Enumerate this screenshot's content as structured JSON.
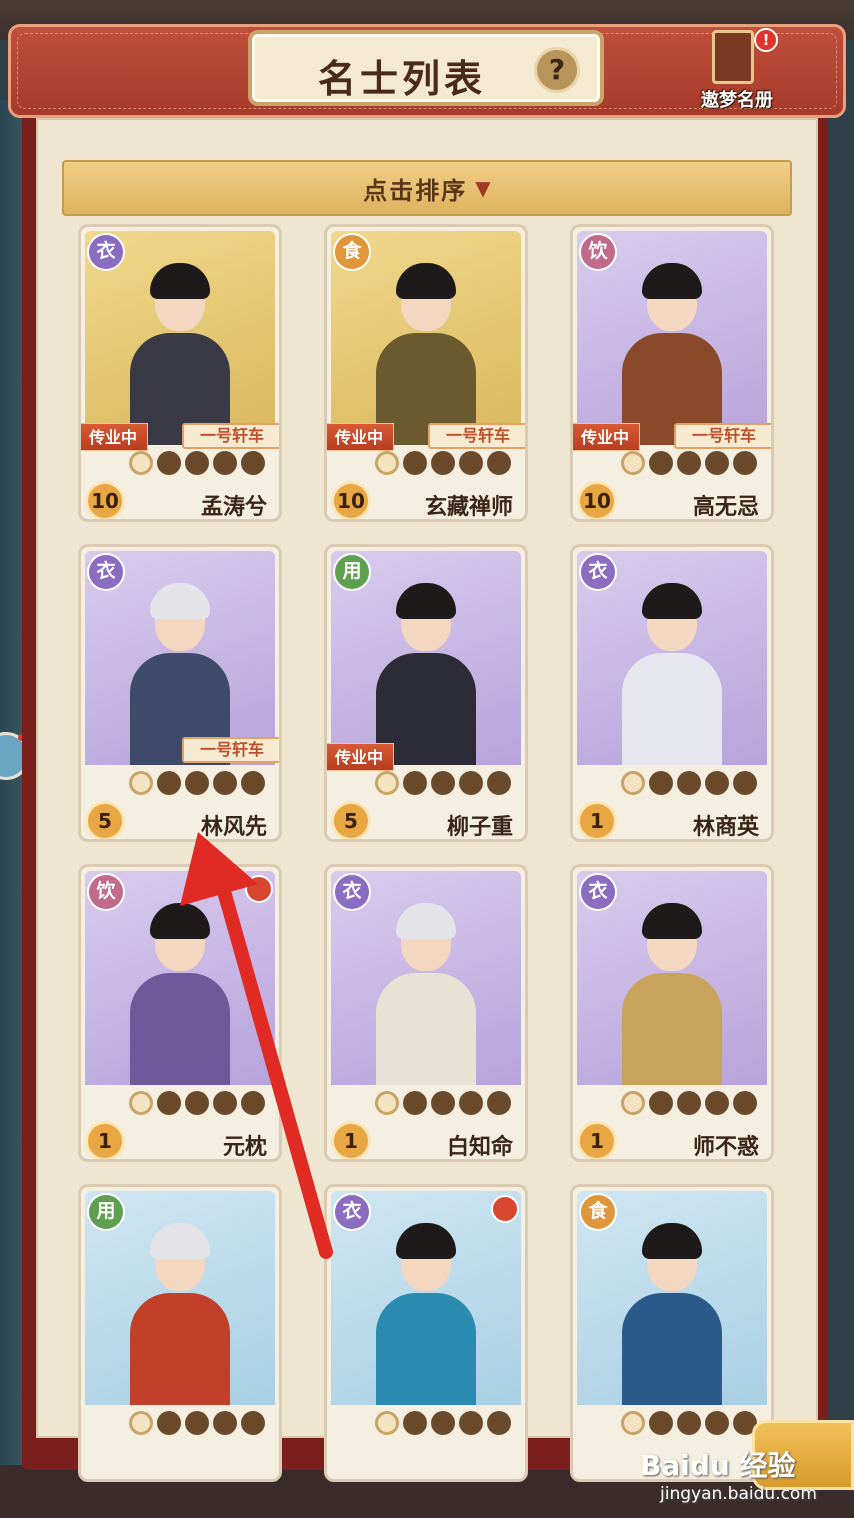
{
  "header": {
    "title": "名士列表",
    "help": "?",
    "roster_label": "遨梦名册",
    "roster_badge": "!"
  },
  "sort": {
    "label": "点击排序",
    "caret": "▼"
  },
  "cards": [
    {
      "name": "孟涛兮",
      "category": "衣",
      "level": "10",
      "teaching": "传业中",
      "car": "一号轩车",
      "stars_lit": 1,
      "stars_total": 5,
      "theme": "gold"
    },
    {
      "name": "玄藏禅师",
      "category": "食",
      "level": "10",
      "teaching": "传业中",
      "car": "一号轩车",
      "stars_lit": 1,
      "stars_total": 5,
      "theme": "gold"
    },
    {
      "name": "高无忌",
      "category": "饮",
      "level": "10",
      "teaching": "传业中",
      "car": "一号轩车",
      "stars_lit": 1,
      "stars_total": 5,
      "theme": "purple"
    },
    {
      "name": "林风先",
      "category": "衣",
      "level": "5",
      "teaching": "",
      "car": "一号轩车",
      "stars_lit": 1,
      "stars_total": 5,
      "theme": "purple"
    },
    {
      "name": "柳子重",
      "category": "用",
      "level": "5",
      "teaching": "传业中",
      "car": "",
      "stars_lit": 1,
      "stars_total": 5,
      "theme": "purple"
    },
    {
      "name": "林商英",
      "category": "衣",
      "level": "1",
      "teaching": "",
      "car": "",
      "stars_lit": 1,
      "stars_total": 5,
      "theme": "purple"
    },
    {
      "name": "元枕",
      "category": "饮",
      "level": "1",
      "teaching": "",
      "car": "",
      "stars_lit": 1,
      "stars_total": 5,
      "theme": "purple"
    },
    {
      "name": "白知命",
      "category": "衣",
      "level": "1",
      "teaching": "",
      "car": "",
      "stars_lit": 1,
      "stars_total": 5,
      "theme": "purple"
    },
    {
      "name": "师不惑",
      "category": "衣",
      "level": "1",
      "teaching": "",
      "car": "",
      "stars_lit": 1,
      "stars_total": 5,
      "theme": "purple"
    },
    {
      "name": "",
      "category": "用",
      "level": "",
      "teaching": "",
      "car": "",
      "stars_lit": 1,
      "stars_total": 5,
      "theme": "blue"
    },
    {
      "name": "",
      "category": "衣",
      "level": "",
      "teaching": "",
      "car": "",
      "stars_lit": 1,
      "stars_total": 5,
      "theme": "blue"
    },
    {
      "name": "",
      "category": "食",
      "level": "",
      "teaching": "",
      "car": "",
      "stars_lit": 1,
      "stars_total": 5,
      "theme": "blue"
    }
  ],
  "watermark": {
    "brand": "Baidu 经验",
    "url": "jingyan.baidu.com"
  },
  "colors": {
    "frame": "#7a1f1c",
    "panel": "#efe6d2",
    "accent": "#d85a34",
    "arrow": "#e02a24"
  }
}
